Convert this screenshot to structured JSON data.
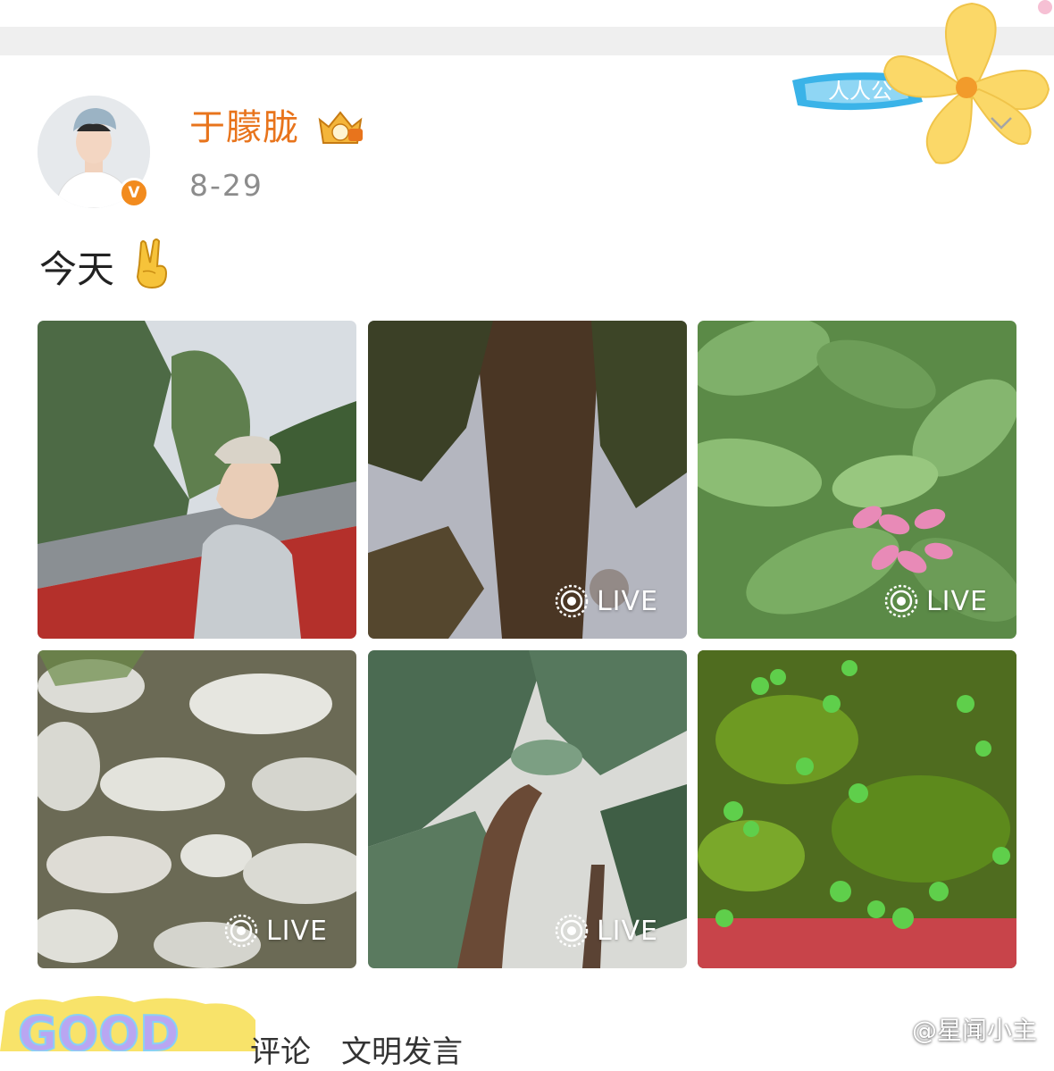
{
  "post": {
    "username": "于朦胧",
    "date": "8-29",
    "text": "今天",
    "emoji_icon": "victory-hand-icon"
  },
  "photos": [
    {
      "live": false,
      "live_label": ""
    },
    {
      "live": true,
      "live_label": "LIVE"
    },
    {
      "live": true,
      "live_label": "LIVE"
    },
    {
      "live": true,
      "live_label": "LIVE"
    },
    {
      "live": true,
      "live_label": "LIVE"
    },
    {
      "live": false,
      "live_label": ""
    }
  ],
  "stickers": {
    "follow_text": "人人公",
    "bottom_bubble_text": "GOOD"
  },
  "comment_prompt": "评论　文明发言",
  "watermark": "@星闻小主",
  "colors": {
    "username": "#e8741c",
    "verified_badge": "#f28b1e",
    "date": "#8c8c8c"
  }
}
